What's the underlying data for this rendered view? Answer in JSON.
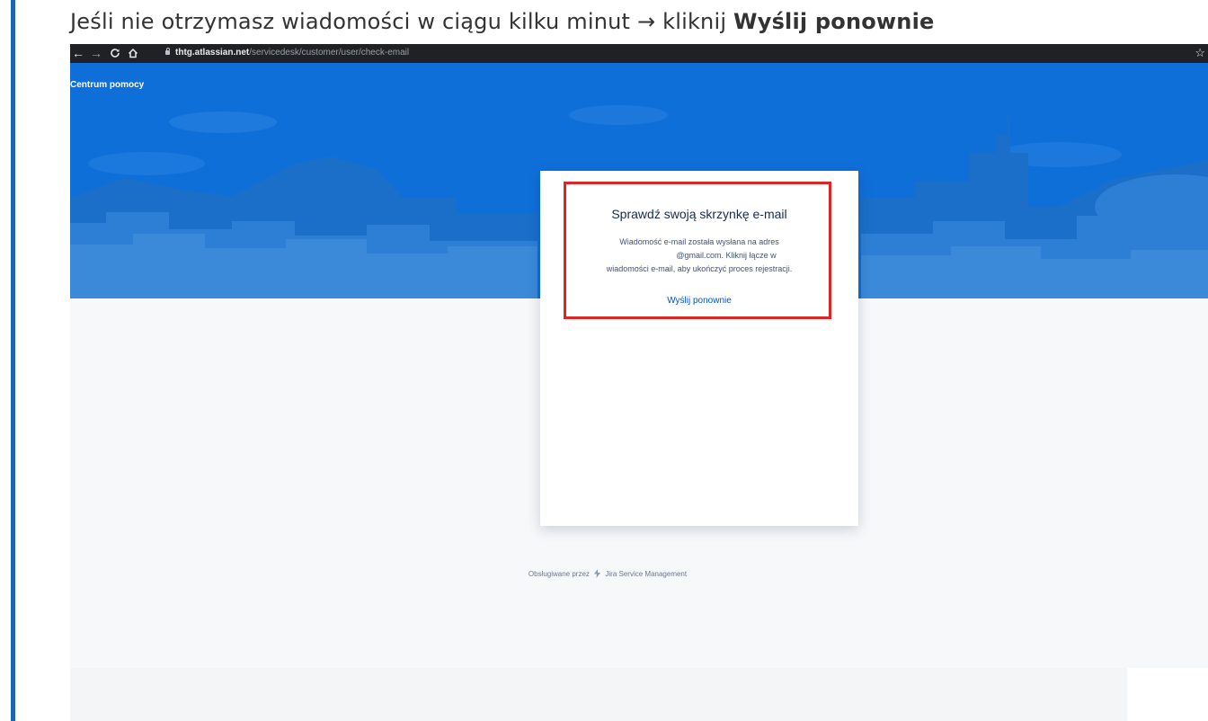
{
  "instruction": {
    "prefix": "Jeśli nie otrzymasz wiadomości w ciągu kilku minut → kliknij ",
    "emphasis": "Wyślij ponownie"
  },
  "browser": {
    "url_domain": "thtg.atlassian.net",
    "url_path": "/servicedesk/customer/user/check-email",
    "icons": {
      "back": "arrow-left-icon",
      "forward": "arrow-right-icon",
      "reload": "reload-icon",
      "home": "home-icon",
      "lock": "lock-icon",
      "bookmark": "star-icon"
    }
  },
  "portal": {
    "brand": "Centrum pomocy",
    "accent_color": "#0f6fd9"
  },
  "card": {
    "title": "Sprawdź swoją skrzynkę e-mail",
    "body_line1": "Wiadomość e-mail została wysłana na adres",
    "body_line2": "@gmail.com. Kliknij łącze w",
    "body_line3": "wiadomości e-mail, aby ukończyć proces rejestracji.",
    "resend_label": "Wyślij ponownie",
    "highlight_color": "#e02424"
  },
  "footer": {
    "prefix": "Obsługiwane przez",
    "product": "Jira Service Management",
    "product_icon": "jira-bolt-icon"
  }
}
